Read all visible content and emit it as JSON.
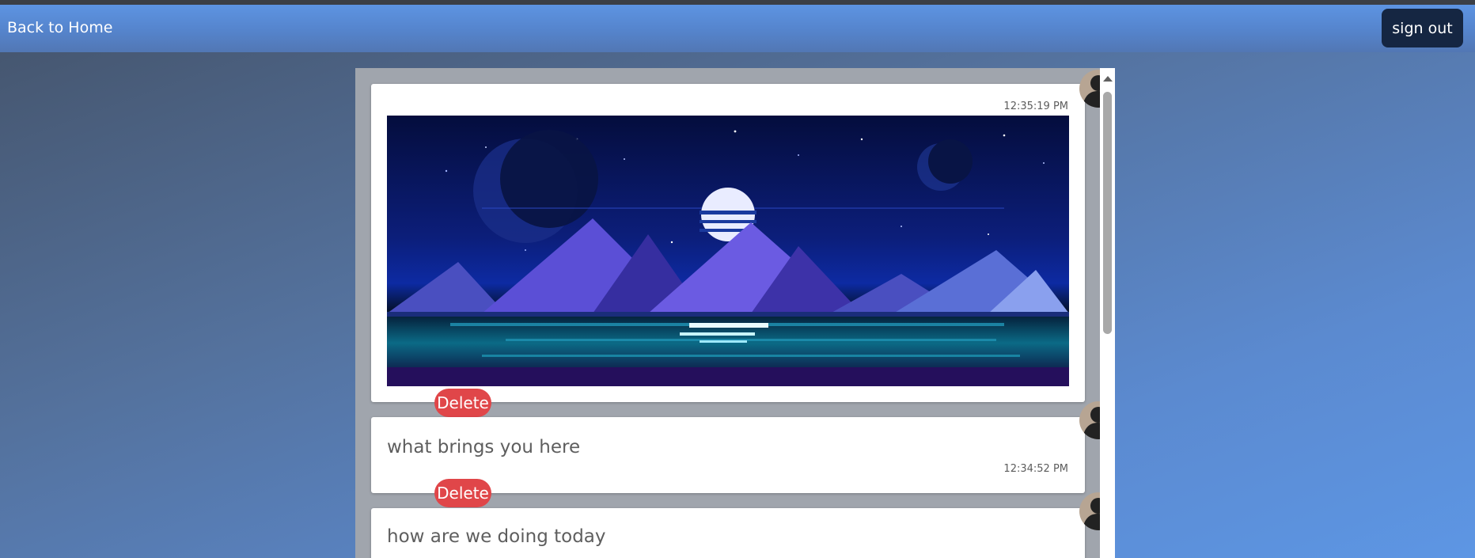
{
  "navbar": {
    "back_label": "Back to Home",
    "signout_label": "sign out"
  },
  "messages": [
    {
      "type": "image",
      "time": "12:35:19 PM",
      "delete_label": "Delete"
    },
    {
      "type": "text",
      "text": "what brings you here",
      "time": "12:34:52 PM",
      "delete_label": "Delete"
    },
    {
      "type": "text",
      "text": "how are we doing today",
      "time": "",
      "delete_label": ""
    }
  ],
  "icons": {
    "avatar": "user-avatar-icon",
    "scroll_up": "scroll-up-arrow-icon"
  },
  "colors": {
    "navbar": "#5584cc",
    "signout_button": "#152642",
    "delete_button": "#e04649",
    "panel": "#a0a5ad"
  }
}
